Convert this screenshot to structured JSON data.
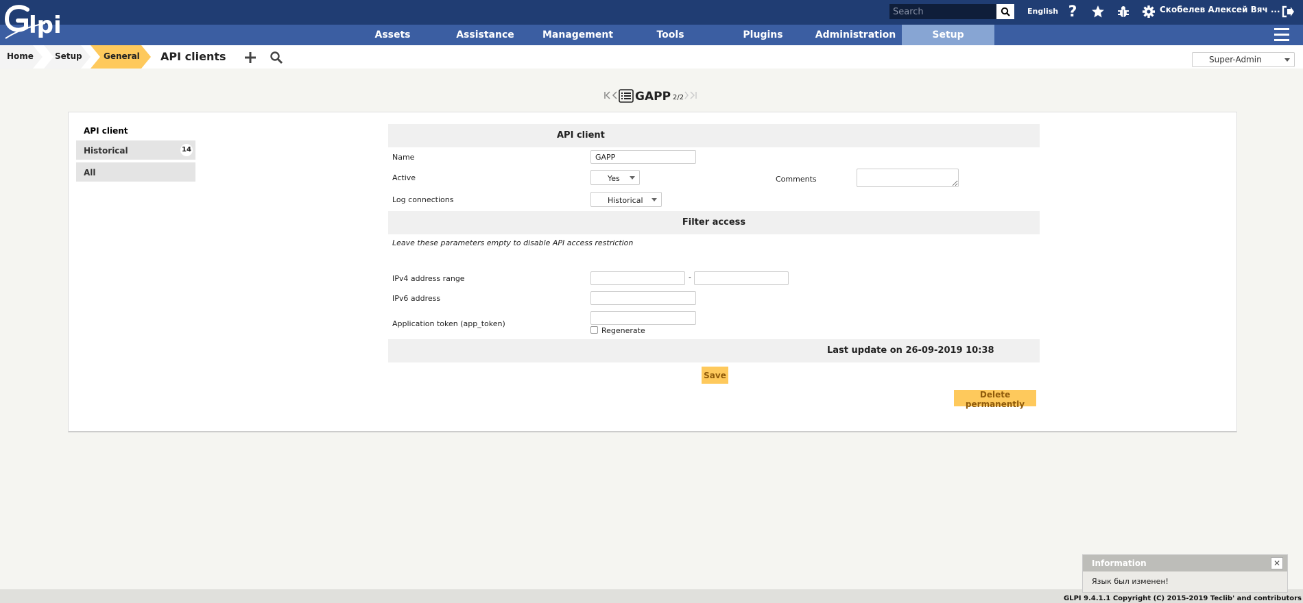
{
  "app": {
    "logo_text": "Glpi"
  },
  "header": {
    "search_placeholder": "Search",
    "language": "English",
    "username": "Скобелев Алексей Вяч ..."
  },
  "nav": {
    "items": [
      "Assets",
      "Assistance",
      "Management",
      "Tools",
      "Plugins",
      "Administration",
      "Setup"
    ],
    "active": "Setup"
  },
  "breadcrumb": {
    "items": [
      "Home",
      "Setup",
      "General"
    ],
    "title": "API clients"
  },
  "profile": {
    "selected": "Super-Admin"
  },
  "record_nav": {
    "title": "GAPP",
    "position": "2/2"
  },
  "tabs": [
    {
      "label": "API client"
    },
    {
      "label": "Historical",
      "count": "14"
    },
    {
      "label": "All"
    }
  ],
  "form": {
    "section_main": "API client",
    "name_label": "Name",
    "name_value": "GAPP",
    "active_label": "Active",
    "active_value": "Yes",
    "comments_label": "Comments",
    "log_label": "Log connections",
    "log_value": "Historical",
    "section_filter": "Filter access",
    "filter_note": "Leave these parameters empty to disable API access restriction",
    "ipv4_label": "IPv4 address range",
    "ipv4_sep": "-",
    "ipv6_label": "IPv6 address",
    "token_label": "Application token (app_token)",
    "regenerate_label": "Regenerate",
    "last_update": "Last update on 26-09-2019 10:38",
    "save_label": "Save",
    "delete_label": "Delete permanently"
  },
  "notification": {
    "title": "Information",
    "message": "Язык был изменен!"
  },
  "footer": {
    "copyright": "GLPI 9.4.1.1 Copyright (C) 2015-2019 Teclib' and contributors"
  },
  "colors": {
    "header_dark": "#203d73",
    "nav": "#3b5ea2",
    "nav_active": "#87a5d3",
    "accent": "#fec95c"
  }
}
